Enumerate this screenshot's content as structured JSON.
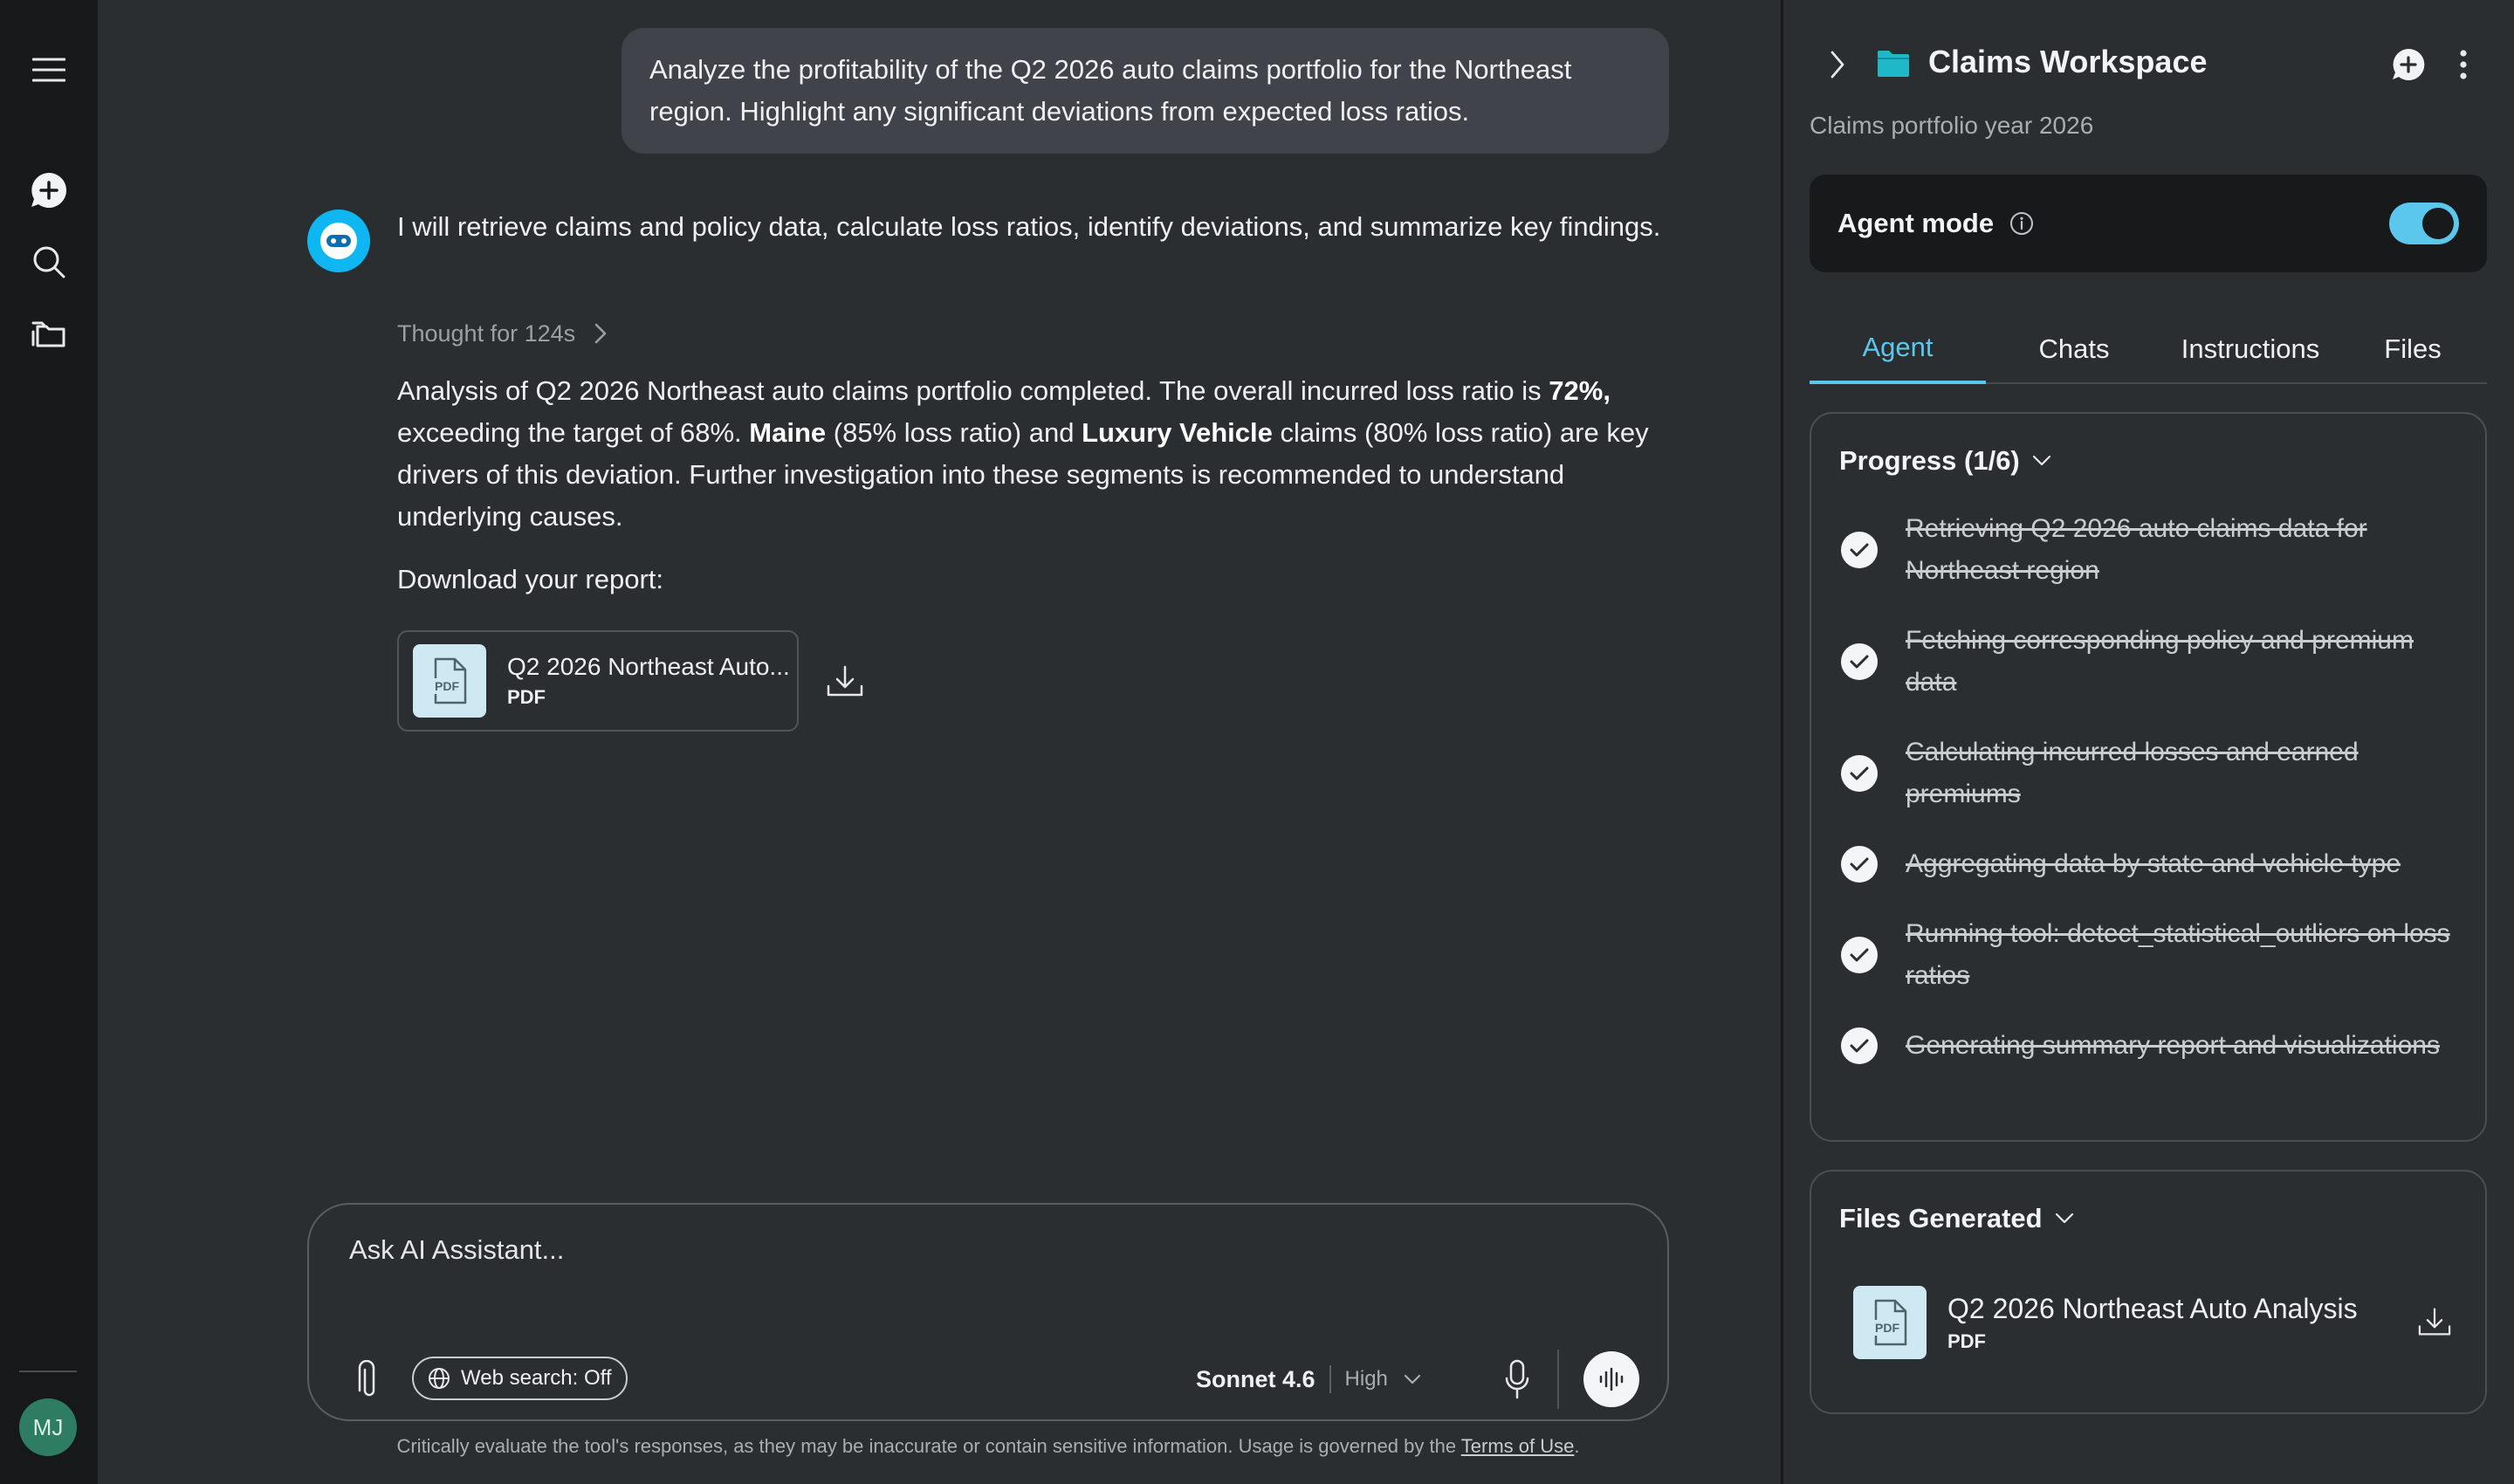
{
  "user": {
    "initials": "MJ",
    "prompt": "Analyze the profitability of the Q2 2026 auto claims portfolio for the Northeast region. Highlight any significant deviations from expected loss ratios."
  },
  "assistant": {
    "intro": "I will retrieve claims and policy data, calculate loss ratios, identify deviations, and summarize key findings.",
    "thought": "Thought for 124s",
    "analysis": {
      "p1": "Analysis of Q2 2026 Northeast auto claims portfolio completed. The overall incurred loss ratio is ",
      "b1": "72%,",
      "p2": " exceeding the target of 68%. ",
      "b2": "Maine",
      "p3": " (85% loss ratio) and ",
      "b3": "Luxury Vehicle",
      "p4": " claims (80% loss ratio) are key drivers of this deviation. Further investigation into these segments is recommended to understand underlying causes."
    },
    "download_label": "Download your report:",
    "file": {
      "name": "Q2 2026 Northeast Auto...",
      "type": "PDF"
    }
  },
  "composer": {
    "placeholder": "Ask AI Assistant...",
    "web_search": "Web search: Off",
    "model": "Sonnet 4.6",
    "effort": "High"
  },
  "disclaimer": {
    "text": "Critically evaluate the tool's responses, as they may be inaccurate or contain sensitive information. Usage is governed by the ",
    "link": "Terms of Use",
    "end": "."
  },
  "panel": {
    "title": "Claims Workspace",
    "subtitle": "Claims portfolio year 2026",
    "agent_mode": {
      "label": "Agent mode",
      "enabled": true
    },
    "tabs": [
      "Agent",
      "Chats",
      "Instructions",
      "Files"
    ],
    "active_tab": "Agent",
    "progress": {
      "title": "Progress (1/6)",
      "steps": [
        "Retrieving Q2 2026 auto claims data for Northeast region",
        "Fetching corresponding policy and premium data",
        "Calculating incurred losses and earned premiums",
        "Aggregating data by state and vehicle type",
        "Running tool: detect_statistical_outliers on loss ratios",
        "Generating summary report and visualizations"
      ]
    },
    "files_generated": {
      "title": "Files Generated",
      "file": {
        "name": "Q2 2026 Northeast Auto Analysis",
        "type": "PDF"
      }
    }
  },
  "colors": {
    "accent": "#5bc7ec",
    "bot_avatar": "#0fb7f2",
    "background": "#2b2e31",
    "rail": "#16181a"
  }
}
